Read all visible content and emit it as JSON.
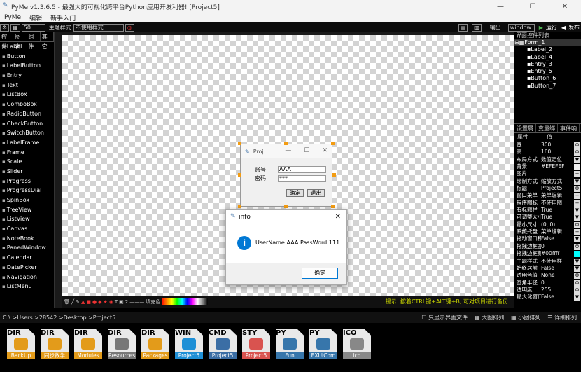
{
  "window": {
    "title": "PyMe v1.3.6.5 - 最强大的可视化跨平台Python应用开发利器!   [Project5]",
    "minimize": "—",
    "maximize": "☐",
    "close": "✕"
  },
  "menu": [
    "PyMe",
    "编辑",
    "新手入门"
  ],
  "toolbar": {
    "size": "50",
    "theme_label": "主题样式",
    "theme_value": "不使用样式",
    "output": "输出",
    "platform": "window",
    "run": "运行",
    "publish": "发布"
  },
  "left_tabs": [
    "控件",
    "图表",
    "组件",
    "其它"
  ],
  "widgets": [
    "Label",
    "Button",
    "LabelButton",
    "Entry",
    "Text",
    "ListBox",
    "ComboBox",
    "RadioButton",
    "CheckButton",
    "SwitchButton",
    "LabelFrame",
    "Frame",
    "Scale",
    "Slider",
    "Progress",
    "ProgressDial",
    "SpinBox",
    "TreeView",
    "ListView",
    "Canvas",
    "NoteBook",
    "PanedWindow",
    "Calendar",
    "DatePicker",
    "Navigation",
    "ListMenu"
  ],
  "right_panel": {
    "title": "界面控件列表",
    "tree_root": "Form_1",
    "tree_items": [
      "Label_2",
      "Label_4",
      "Entry_3",
      "Entry_5",
      "Button_6",
      "Button_7"
    ],
    "tabs": [
      "设置属",
      "变量绑",
      "事件响"
    ],
    "prop_header": [
      "属性",
      "值"
    ],
    "props": [
      {
        "k": "宽",
        "v": "300",
        "b": "⚙"
      },
      {
        "k": "高",
        "v": "160",
        "b": "⚙"
      },
      {
        "k": "布局方式",
        "v": "数值定位",
        "b": "▼"
      },
      {
        "k": "背景",
        "v": "#EFEFEF",
        "b": ""
      },
      {
        "k": "图片",
        "v": "",
        "b": "+"
      },
      {
        "k": "绘制方式",
        "v": "缩放方式",
        "b": "▼"
      },
      {
        "k": "标题",
        "v": "Project5",
        "b": "⚙"
      },
      {
        "k": "窗口菜单",
        "v": "菜单编辑",
        "b": "+"
      },
      {
        "k": "程序图标",
        "v": "不使用图",
        "b": "+"
      },
      {
        "k": "有标题栏",
        "v": "True",
        "b": "▼"
      },
      {
        "k": "可调整大小",
        "v": "True",
        "b": "▼"
      },
      {
        "k": "最小尺寸",
        "v": "(0, 0)",
        "b": "⚙"
      },
      {
        "k": "系统托盘",
        "v": "菜单编辑",
        "b": "+"
      },
      {
        "k": "拖动窗口移动",
        "v": "False",
        "b": "▼"
      },
      {
        "k": "拖拽边框宽度",
        "v": "0",
        "b": "⚙"
      },
      {
        "k": "拖拽边框颜色",
        "v": "#00ffff",
        "b": ""
      },
      {
        "k": "主题样式",
        "v": "不使用样",
        "b": "▼"
      },
      {
        "k": "始终居前",
        "v": "False",
        "b": "▼"
      },
      {
        "k": "透明色值",
        "v": "None",
        "b": "⚙"
      },
      {
        "k": "圆角半径",
        "v": "0",
        "b": "⚙"
      },
      {
        "k": "透明度",
        "v": "255",
        "b": "⚙"
      },
      {
        "k": "最大化窗口",
        "v": "False",
        "b": "▼"
      }
    ]
  },
  "designer_form": {
    "title": "Proj...",
    "label1": "账号",
    "label2": "密码",
    "entry1": "AAA",
    "entry2": "***",
    "btn_ok": "确定",
    "btn_exit": "退出"
  },
  "info_dialog": {
    "title": "info",
    "message": "UserName:AAA   PassWord:111",
    "ok": "确定",
    "close": "✕"
  },
  "drawbar": {
    "line_width": "2",
    "tip": "提示: 按着CTRL键+ALT键+B, 可对项目进行备份",
    "line_style": "———",
    "fill": "填充色"
  },
  "pathbar": {
    "path": "C:\\ >Users >28542 >Desktop >Project5",
    "opt1": "只显示界面文件",
    "opt2": "大图排列",
    "opt3": "小图排列",
    "opt4": "详细排列"
  },
  "files": [
    {
      "tag": "DIR",
      "label": "BackUp",
      "color": "#e39b1a"
    },
    {
      "tag": "DIR",
      "label": "同步数学",
      "color": "#e39b1a"
    },
    {
      "tag": "DIR",
      "label": "Modules",
      "color": "#e39b1a"
    },
    {
      "tag": "DIR",
      "label": "Resources",
      "color": "#777777"
    },
    {
      "tag": "DIR",
      "label": "Packages",
      "color": "#e39b1a"
    },
    {
      "tag": "WIN",
      "label": "Project5",
      "color": "#1e8fd6"
    },
    {
      "tag": "CMD",
      "label": "Project5",
      "color": "#3b6ea5"
    },
    {
      "tag": "STY",
      "label": "Project5",
      "color": "#d9534f"
    },
    {
      "tag": "PY",
      "label": "Fun",
      "color": "#3776ab"
    },
    {
      "tag": "PY",
      "label": "EXUICom",
      "color": "#3776ab"
    },
    {
      "tag": "ICO",
      "label": "ico",
      "color": "#888888"
    }
  ]
}
